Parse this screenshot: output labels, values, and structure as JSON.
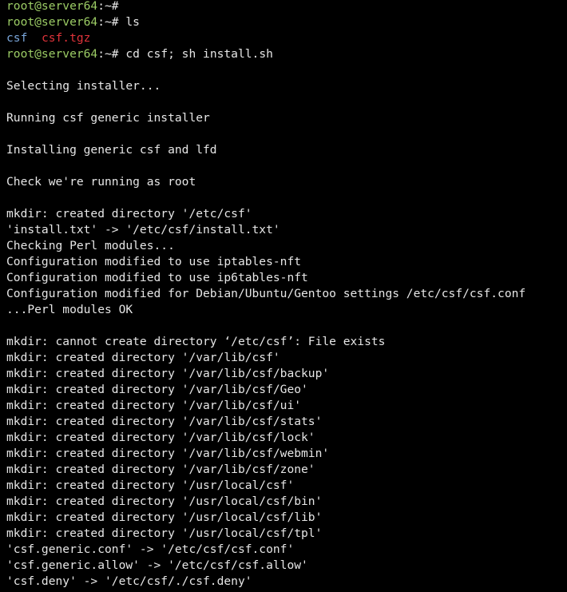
{
  "terminal": {
    "colors": {
      "background": "#000000",
      "foreground": "#e6e6e6",
      "prompt": "#9ccc65",
      "directory": "#7aa6da",
      "archive": "#e0333a"
    },
    "prompt": {
      "user_host": "root@server64",
      "separator": ":~# "
    },
    "commands": {
      "first": "",
      "second": "ls",
      "third": "cd csf; sh install.sh"
    },
    "ls_output": {
      "dir": "csf",
      "gap": "  ",
      "archive": "csf.tgz"
    },
    "output_lines": [
      "",
      "Selecting installer...",
      "",
      "Running csf generic installer",
      "",
      "Installing generic csf and lfd",
      "",
      "Check we're running as root",
      "",
      "mkdir: created directory '/etc/csf'",
      "'install.txt' -> '/etc/csf/install.txt'",
      "Checking Perl modules...",
      "Configuration modified to use iptables-nft",
      "Configuration modified to use ip6tables-nft",
      "Configuration modified for Debian/Ubuntu/Gentoo settings /etc/csf/csf.conf",
      "...Perl modules OK",
      "",
      "mkdir: cannot create directory ‘/etc/csf’: File exists",
      "mkdir: created directory '/var/lib/csf'",
      "mkdir: created directory '/var/lib/csf/backup'",
      "mkdir: created directory '/var/lib/csf/Geo'",
      "mkdir: created directory '/var/lib/csf/ui'",
      "mkdir: created directory '/var/lib/csf/stats'",
      "mkdir: created directory '/var/lib/csf/lock'",
      "mkdir: created directory '/var/lib/csf/webmin'",
      "mkdir: created directory '/var/lib/csf/zone'",
      "mkdir: created directory '/usr/local/csf'",
      "mkdir: created directory '/usr/local/csf/bin'",
      "mkdir: created directory '/usr/local/csf/lib'",
      "mkdir: created directory '/usr/local/csf/tpl'",
      "'csf.generic.conf' -> '/etc/csf/csf.conf'",
      "'csf.generic.allow' -> '/etc/csf/csf.allow'",
      "'csf.deny' -> '/etc/csf/./csf.deny'"
    ]
  }
}
